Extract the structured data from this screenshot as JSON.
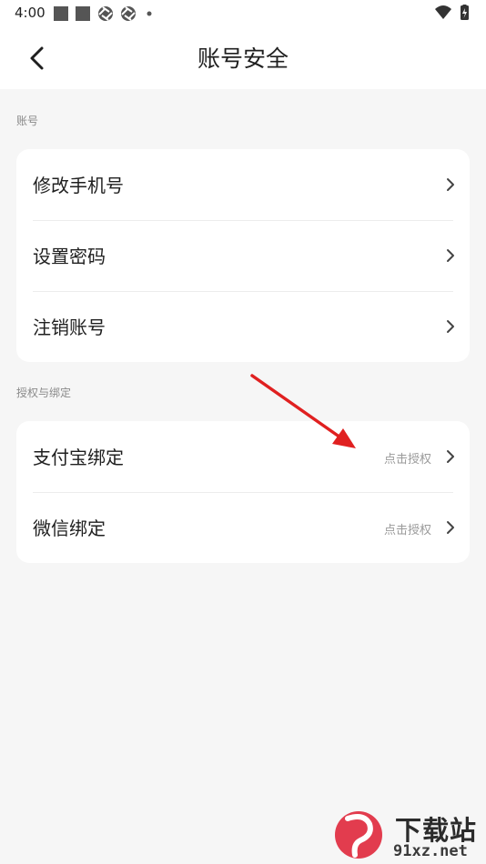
{
  "status_bar": {
    "time": "4:00",
    "left_icons": [
      "square-icon",
      "square-icon",
      "aperture-icon",
      "aperture-icon",
      "dot-icon"
    ],
    "right_icons": [
      "wifi-icon",
      "battery-icon"
    ]
  },
  "header": {
    "title": "账号安全",
    "back_icon": "chevron-left-icon"
  },
  "sections": [
    {
      "label": "账号",
      "items": [
        {
          "label": "修改手机号",
          "status": ""
        },
        {
          "label": "设置密码",
          "status": ""
        },
        {
          "label": "注销账号",
          "status": ""
        }
      ]
    },
    {
      "label": "授权与绑定",
      "items": [
        {
          "label": "支付宝绑定",
          "status": "点击授权"
        },
        {
          "label": "微信绑定",
          "status": "点击授权"
        }
      ]
    }
  ],
  "annotation": {
    "color": "#e02020"
  },
  "watermark": {
    "title": "下载站",
    "url": "91xz.net"
  },
  "colors": {
    "accent_red": "#e02020",
    "text_primary": "#1f1f1f",
    "text_secondary": "#9a9a9a"
  }
}
